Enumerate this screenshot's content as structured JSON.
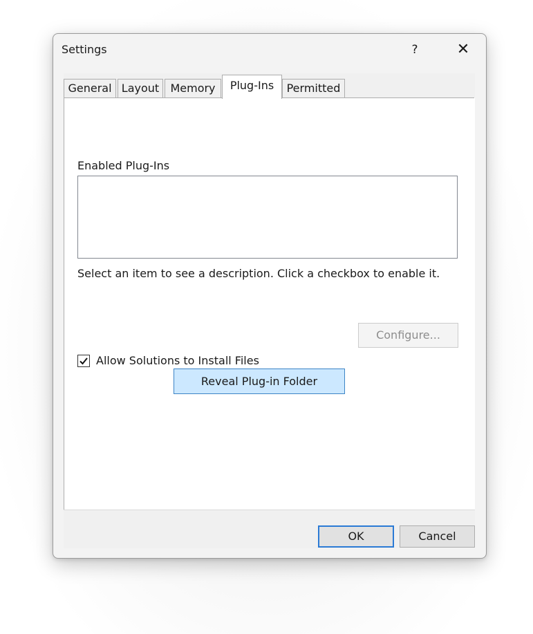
{
  "window": {
    "title": "Settings",
    "help_label": "?",
    "close_label": "✕"
  },
  "tabs": [
    {
      "label": "General"
    },
    {
      "label": "Layout"
    },
    {
      "label": "Memory"
    },
    {
      "label": "Plug-Ins",
      "active": true
    },
    {
      "label": "Permitted"
    }
  ],
  "plugins": {
    "list_label": "Enabled Plug-Ins",
    "items": [],
    "description": "Select an item to see a description. Click a checkbox to enable it.",
    "configure_label": "Configure...",
    "configure_enabled": false,
    "allow_install_label": "Allow Solutions to Install Files",
    "allow_install_checked": true,
    "reveal_folder_label": "Reveal Plug-in Folder"
  },
  "footer": {
    "ok_label": "OK",
    "cancel_label": "Cancel"
  },
  "colors": {
    "reveal_button_bg": "#cce8ff",
    "reveal_button_border": "#3c84c6",
    "ok_button_border": "#2a7ad5",
    "disabled_text": "#8d8d8d"
  }
}
